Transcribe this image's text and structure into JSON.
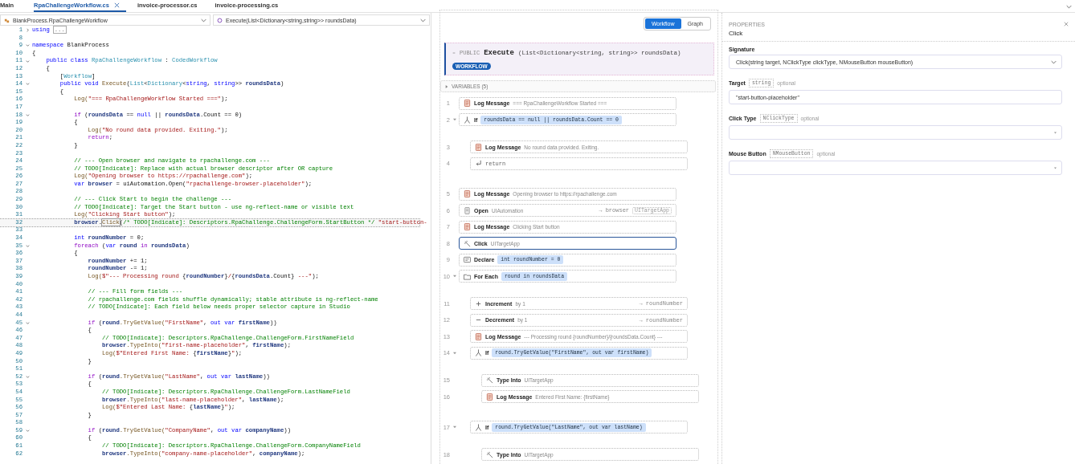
{
  "tabs": [
    {
      "label": "Main",
      "selected": false
    },
    {
      "label": "RpaChallengeWorkflow.cs",
      "selected": true
    },
    {
      "label": "invoice-processor.cs",
      "selected": false
    },
    {
      "label": "invoice-processing.cs",
      "selected": false
    }
  ],
  "navigation": {
    "type_selector": "BlankProcess.RpaChallengeWorkflow",
    "member_selector": "Execute(List<Dictionary<string,string>> roundsData)"
  },
  "editor": {
    "lines": [
      {
        "number": "1",
        "expanded": false,
        "current": false,
        "tokens": [
          {
            "text": "using",
            "kind": "keyword"
          },
          {
            "text": "...",
            "kind": "collapsed"
          }
        ]
      },
      {
        "number": "8",
        "current": false
      },
      {
        "number": "9",
        "expanded": true,
        "current": false,
        "tokens": [
          {
            "text": "namespace",
            "kind": "keyword"
          },
          {
            "text": " BlankProcess",
            "kind": "plain"
          }
        ]
      },
      {
        "number": "10",
        "current": false,
        "tokens": [
          {
            "text": "{",
            "kind": "plain"
          }
        ]
      },
      {
        "number": "11",
        "expanded": true,
        "current": false,
        "tokens": [
          {
            "text": "    public class ",
            "kind": "keyword"
          },
          {
            "text": "RpaChallengeWorkflow",
            "kind": "type"
          },
          {
            "text": " : ",
            "kind": "plain"
          },
          {
            "text": "CodedWorkflow",
            "kind": "type"
          }
        ]
      },
      {
        "number": "12",
        "current": false,
        "tokens": [
          {
            "text": "    {",
            "kind": "plain"
          }
        ]
      },
      {
        "number": "13",
        "current": false,
        "tokens": [
          {
            "text": "        [",
            "kind": "plain"
          },
          {
            "text": "Workflow",
            "kind": "type"
          },
          {
            "text": "]",
            "kind": "plain"
          }
        ]
      },
      {
        "number": "14",
        "expanded": true,
        "current": false,
        "tokens": [
          {
            "text": "        public void ",
            "kind": "keyword"
          },
          {
            "text": "Execute",
            "kind": "method"
          },
          {
            "text": "(",
            "kind": "plain"
          },
          {
            "text": "List",
            "kind": "type"
          },
          {
            "text": "<",
            "kind": "plain"
          },
          {
            "text": "Dictionary",
            "kind": "type"
          },
          {
            "text": "<",
            "kind": "plain"
          },
          {
            "text": "string",
            "kind": "keyword"
          },
          {
            "text": ", ",
            "kind": "plain"
          },
          {
            "text": "string",
            "kind": "keyword"
          },
          {
            "text": ">> ",
            "kind": "plain"
          },
          {
            "text": "roundsData",
            "kind": "ident"
          },
          {
            "text": ")",
            "kind": "plain"
          }
        ]
      },
      {
        "number": "15",
        "current": false,
        "tokens": [
          {
            "text": "        {",
            "kind": "plain"
          }
        ]
      },
      {
        "number": "16",
        "current": false,
        "tokens": [
          {
            "text": "            Log(",
            "kind": "method"
          },
          {
            "text": "\"=== RpaChallengeWorkflow Started ===\"",
            "kind": "string"
          },
          {
            "text": ");",
            "kind": "plain"
          }
        ]
      },
      {
        "number": "17",
        "current": false
      },
      {
        "number": "18",
        "expanded": true,
        "current": false,
        "tokens": [
          {
            "text": "            if",
            "kind": "control"
          },
          {
            "text": " (",
            "kind": "plain"
          },
          {
            "text": "roundsData",
            "kind": "ident"
          },
          {
            "text": " == ",
            "kind": "plain"
          },
          {
            "text": "null",
            "kind": "keyword"
          },
          {
            "text": " || ",
            "kind": "plain"
          },
          {
            "text": "roundsData",
            "kind": "ident"
          },
          {
            "text": ".Count == 0)",
            "kind": "plain"
          }
        ]
      },
      {
        "number": "19",
        "current": false,
        "tokens": [
          {
            "text": "            {",
            "kind": "plain"
          }
        ]
      },
      {
        "number": "20",
        "current": false,
        "tokens": [
          {
            "text": "                Log(",
            "kind": "method"
          },
          {
            "text": "\"No round data provided. Exiting.\"",
            "kind": "string"
          },
          {
            "text": ");",
            "kind": "plain"
          }
        ]
      },
      {
        "number": "21",
        "current": false,
        "tokens": [
          {
            "text": "                return",
            "kind": "control"
          },
          {
            "text": ";",
            "kind": "plain"
          }
        ]
      },
      {
        "number": "22",
        "current": false,
        "tokens": [
          {
            "text": "            }",
            "kind": "plain"
          }
        ]
      },
      {
        "number": "23",
        "current": false
      },
      {
        "number": "24",
        "current": false,
        "tokens": [
          {
            "text": "            // --- Open browser and navigate to rpachallenge.com ---",
            "kind": "comment"
          }
        ]
      },
      {
        "number": "25",
        "current": false,
        "tokens": [
          {
            "text": "            // TODO[Indicate]: Replace with actual browser descriptor after OR capture",
            "kind": "comment"
          }
        ]
      },
      {
        "number": "26",
        "current": false,
        "tokens": [
          {
            "text": "            Log(",
            "kind": "method"
          },
          {
            "text": "\"Opening browser to https://rpachallenge.com\"",
            "kind": "string"
          },
          {
            "text": ");",
            "kind": "plain"
          }
        ]
      },
      {
        "number": "27",
        "current": false,
        "tokens": [
          {
            "text": "            var",
            "kind": "keyword"
          },
          {
            "text": " browser",
            "kind": "ident"
          },
          {
            "text": " = uiAutomation.Open(",
            "kind": "plain"
          },
          {
            "text": "\"rpachallenge-browser-placeholder\"",
            "kind": "string"
          },
          {
            "text": ");",
            "kind": "plain"
          }
        ]
      },
      {
        "number": "28",
        "current": false
      },
      {
        "number": "29",
        "current": false,
        "tokens": [
          {
            "text": "            // --- Click Start to begin the challenge ---",
            "kind": "comment"
          }
        ]
      },
      {
        "number": "30",
        "current": false,
        "tokens": [
          {
            "text": "            // TODO[Indicate]: Target the Start button - use ng-reflect-name or visible text",
            "kind": "comment"
          }
        ]
      },
      {
        "number": "31",
        "current": false,
        "tokens": [
          {
            "text": "            Log(",
            "kind": "method"
          },
          {
            "text": "\"Clicking Start button\"",
            "kind": "string"
          },
          {
            "text": ");",
            "kind": "plain"
          }
        ]
      },
      {
        "number": "32",
        "current": true,
        "tokens": [
          {
            "text": "            browser",
            "kind": "ident"
          },
          {
            "text": ".",
            "kind": "plain"
          },
          {
            "text": "Click",
            "kind": "match"
          },
          {
            "text": "(",
            "kind": "plain"
          },
          {
            "text": "/* TODO[Indicate]: Descriptors.RpaChallenge.ChallengeForm.StartButton */",
            "kind": "comment"
          },
          {
            "text": " \"start-button-",
            "kind": "string"
          }
        ]
      },
      {
        "number": "33",
        "current": false
      },
      {
        "number": "34",
        "current": false,
        "tokens": [
          {
            "text": "            int",
            "kind": "keyword"
          },
          {
            "text": " roundNumber",
            "kind": "ident"
          },
          {
            "text": " = 0;",
            "kind": "plain"
          }
        ]
      },
      {
        "number": "35",
        "expanded": true,
        "current": false,
        "tokens": [
          {
            "text": "            foreach",
            "kind": "control"
          },
          {
            "text": " (",
            "kind": "plain"
          },
          {
            "text": "var",
            "kind": "keyword"
          },
          {
            "text": " round ",
            "kind": "ident"
          },
          {
            "text": "in",
            "kind": "control"
          },
          {
            "text": " roundsData",
            "kind": "ident"
          },
          {
            "text": ")",
            "kind": "plain"
          }
        ]
      },
      {
        "number": "36",
        "current": false,
        "tokens": [
          {
            "text": "            {",
            "kind": "plain"
          }
        ]
      },
      {
        "number": "37",
        "current": false,
        "tokens": [
          {
            "text": "                roundNumber",
            "kind": "ident"
          },
          {
            "text": " += 1;",
            "kind": "plain"
          }
        ]
      },
      {
        "number": "38",
        "current": false,
        "tokens": [
          {
            "text": "                roundNumber",
            "kind": "ident"
          },
          {
            "text": " -= 1;",
            "kind": "plain"
          }
        ]
      },
      {
        "number": "39",
        "current": false,
        "tokens": [
          {
            "text": "                Log(",
            "kind": "method"
          },
          {
            "text": "$\"--- Processing round ",
            "kind": "string"
          },
          {
            "text": "{",
            "kind": "plain"
          },
          {
            "text": "roundNumber",
            "kind": "ident"
          },
          {
            "text": "}",
            "kind": "plain"
          },
          {
            "text": "/",
            "kind": "string"
          },
          {
            "text": "{",
            "kind": "plain"
          },
          {
            "text": "roundsData",
            "kind": "ident"
          },
          {
            "text": ".Count}",
            "kind": "plain"
          },
          {
            "text": " ---\"",
            "kind": "string"
          },
          {
            "text": ");",
            "kind": "plain"
          }
        ]
      },
      {
        "number": "40",
        "current": false
      },
      {
        "number": "41",
        "current": false,
        "tokens": [
          {
            "text": "                // --- Fill form fields ---",
            "kind": "comment"
          }
        ]
      },
      {
        "number": "42",
        "current": false,
        "tokens": [
          {
            "text": "                // rpachallenge.com fields shuffle dynamically; stable attribute is ng-reflect-name",
            "kind": "comment"
          }
        ]
      },
      {
        "number": "43",
        "current": false,
        "tokens": [
          {
            "text": "                // TODO[Indicate]: Each field below needs proper selector capture in Studio",
            "kind": "comment"
          }
        ]
      },
      {
        "number": "44",
        "current": false
      },
      {
        "number": "45",
        "expanded": true,
        "current": false,
        "tokens": [
          {
            "text": "                if",
            "kind": "control"
          },
          {
            "text": " (",
            "kind": "plain"
          },
          {
            "text": "round",
            "kind": "ident"
          },
          {
            "text": ".TryGetValue(",
            "kind": "method"
          },
          {
            "text": "\"FirstName\"",
            "kind": "string"
          },
          {
            "text": ", ",
            "kind": "plain"
          },
          {
            "text": "out var",
            "kind": "keyword"
          },
          {
            "text": " firstName",
            "kind": "ident"
          },
          {
            "text": "))",
            "kind": "plain"
          }
        ]
      },
      {
        "number": "46",
        "current": false,
        "tokens": [
          {
            "text": "                {",
            "kind": "plain"
          }
        ]
      },
      {
        "number": "47",
        "current": false,
        "tokens": [
          {
            "text": "                    // TODO[Indicate]: Descriptors.RpaChallenge.ChallengeForm.FirstNameField",
            "kind": "comment"
          }
        ]
      },
      {
        "number": "48",
        "current": false,
        "tokens": [
          {
            "text": "                    browser",
            "kind": "ident"
          },
          {
            "text": ".TypeInto(",
            "kind": "method"
          },
          {
            "text": "\"first-name-placeholder\"",
            "kind": "string"
          },
          {
            "text": ", ",
            "kind": "plain"
          },
          {
            "text": "firstName",
            "kind": "ident"
          },
          {
            "text": ");",
            "kind": "plain"
          }
        ]
      },
      {
        "number": "49",
        "current": false,
        "tokens": [
          {
            "text": "                    Log(",
            "kind": "method"
          },
          {
            "text": "$\"Entered First Name: ",
            "kind": "string"
          },
          {
            "text": "{",
            "kind": "plain"
          },
          {
            "text": "firstName",
            "kind": "ident"
          },
          {
            "text": "}",
            "kind": "plain"
          },
          {
            "text": "\"",
            "kind": "string"
          },
          {
            "text": ");",
            "kind": "plain"
          }
        ]
      },
      {
        "number": "50",
        "current": false,
        "tokens": [
          {
            "text": "                }",
            "kind": "plain"
          }
        ]
      },
      {
        "number": "51",
        "current": false
      },
      {
        "number": "52",
        "expanded": true,
        "current": false,
        "tokens": [
          {
            "text": "                if",
            "kind": "control"
          },
          {
            "text": " (",
            "kind": "plain"
          },
          {
            "text": "round",
            "kind": "ident"
          },
          {
            "text": ".TryGetValue(",
            "kind": "method"
          },
          {
            "text": "\"LastName\"",
            "kind": "string"
          },
          {
            "text": ", ",
            "kind": "plain"
          },
          {
            "text": "out var",
            "kind": "keyword"
          },
          {
            "text": " lastName",
            "kind": "ident"
          },
          {
            "text": "))",
            "kind": "plain"
          }
        ]
      },
      {
        "number": "53",
        "current": false,
        "tokens": [
          {
            "text": "                {",
            "kind": "plain"
          }
        ]
      },
      {
        "number": "54",
        "current": false,
        "tokens": [
          {
            "text": "                    // TODO[Indicate]: Descriptors.RpaChallenge.ChallengeForm.LastNameField",
            "kind": "comment"
          }
        ]
      },
      {
        "number": "55",
        "current": false,
        "tokens": [
          {
            "text": "                    browser",
            "kind": "ident"
          },
          {
            "text": ".TypeInto(",
            "kind": "method"
          },
          {
            "text": "\"last-name-placeholder\"",
            "kind": "string"
          },
          {
            "text": ", ",
            "kind": "plain"
          },
          {
            "text": "lastName",
            "kind": "ident"
          },
          {
            "text": ");",
            "kind": "plain"
          }
        ]
      },
      {
        "number": "56",
        "current": false,
        "tokens": [
          {
            "text": "                    Log(",
            "kind": "method"
          },
          {
            "text": "$\"Entered Last Name: ",
            "kind": "string"
          },
          {
            "text": "{",
            "kind": "plain"
          },
          {
            "text": "lastName",
            "kind": "ident"
          },
          {
            "text": "}",
            "kind": "plain"
          },
          {
            "text": "\"",
            "kind": "string"
          },
          {
            "text": ");",
            "kind": "plain"
          }
        ]
      },
      {
        "number": "57",
        "current": false,
        "tokens": [
          {
            "text": "                }",
            "kind": "plain"
          }
        ]
      },
      {
        "number": "58",
        "current": false
      },
      {
        "number": "59",
        "expanded": true,
        "current": false,
        "tokens": [
          {
            "text": "                if",
            "kind": "control"
          },
          {
            "text": " (",
            "kind": "plain"
          },
          {
            "text": "round",
            "kind": "ident"
          },
          {
            "text": ".TryGetValue(",
            "kind": "method"
          },
          {
            "text": "\"CompanyName\"",
            "kind": "string"
          },
          {
            "text": ", ",
            "kind": "plain"
          },
          {
            "text": "out var",
            "kind": "keyword"
          },
          {
            "text": " companyName",
            "kind": "ident"
          },
          {
            "text": "))",
            "kind": "plain"
          }
        ]
      },
      {
        "number": "60",
        "current": false,
        "tokens": [
          {
            "text": "                {",
            "kind": "plain"
          }
        ]
      },
      {
        "number": "61",
        "current": false,
        "tokens": [
          {
            "text": "                    // TODO[Indicate]: Descriptors.RpaChallenge.ChallengeForm.CompanyNameField",
            "kind": "comment"
          }
        ]
      },
      {
        "number": "62",
        "current": false,
        "tokens": [
          {
            "text": "                    browser",
            "kind": "ident"
          },
          {
            "text": ".TypeInto(",
            "kind": "method"
          },
          {
            "text": "\"company-name-placeholder\"",
            "kind": "string"
          },
          {
            "text": ", ",
            "kind": "plain"
          },
          {
            "text": "companyName",
            "kind": "ident"
          },
          {
            "text": ");",
            "kind": "plain"
          }
        ]
      }
    ]
  },
  "workflow": {
    "view_toggle": [
      {
        "label": "Workflow",
        "selected": true
      },
      {
        "label": "Graph",
        "selected": false
      }
    ],
    "method": {
      "modifier": "PUBLIC",
      "name": "Execute",
      "signature": "(List<Dictionary<string, string>> roundsData)",
      "badge": "WORKFLOW"
    },
    "variables": {
      "label": "VARIABLES (5)",
      "expanded": false
    },
    "steps": [
      {
        "number": "1",
        "kind": "log",
        "title": "Log Message",
        "detail": "=== RpaChallengeWorkflow Started ===",
        "selected": false
      },
      {
        "number": "2",
        "kind": "if",
        "title": "If",
        "expression": "roundsData == null || roundsData.Count == 0",
        "expanded": true,
        "selected": false,
        "children": [
          {
            "number": "3",
            "kind": "log",
            "title": "Log Message",
            "detail": "No round data provided. Exiting.",
            "selected": false
          },
          {
            "number": "4",
            "kind": "return",
            "title": "return",
            "selected": false
          }
        ]
      },
      {
        "number": "5",
        "kind": "log",
        "title": "Log Message",
        "detail": "Opening browser to https://rpachallenge.com",
        "selected": false
      },
      {
        "number": "6",
        "kind": "open",
        "title": "Open",
        "detail": "UIAutomation",
        "output": "→ browser",
        "tag": "UITargetApp",
        "selected": false
      },
      {
        "number": "7",
        "kind": "log",
        "title": "Log Message",
        "detail": "Clicking Start button",
        "selected": false
      },
      {
        "number": "8",
        "kind": "click",
        "title": "Click",
        "detail": "UITargetApp",
        "selected": true
      },
      {
        "number": "9",
        "kind": "declare",
        "title": "Declare",
        "expression": "int roundNumber = 0",
        "selected": false
      },
      {
        "number": "10",
        "kind": "foreach",
        "title": "For Each",
        "expression": "round in roundsData",
        "expanded": true,
        "selected": false,
        "children": [
          {
            "number": "11",
            "kind": "increment",
            "title": "Increment",
            "detail": "by 1",
            "output": "→ roundNumber",
            "selected": false
          },
          {
            "number": "12",
            "kind": "decrement",
            "title": "Decrement",
            "detail": "by 1",
            "output": "→ roundNumber",
            "selected": false
          },
          {
            "number": "13",
            "kind": "log",
            "title": "Log Message",
            "detail": "--- Processing round {roundNumber}/{roundsData.Count} ---",
            "selected": false
          },
          {
            "number": "14",
            "kind": "if",
            "title": "If",
            "expression": "round.TryGetValue(\"FirstName\", out var firstName)",
            "expanded": true,
            "selected": false,
            "children": [
              {
                "number": "15",
                "kind": "typeinto",
                "title": "Type Into",
                "detail": "UITargetApp",
                "selected": false
              },
              {
                "number": "16",
                "kind": "log",
                "title": "Log Message",
                "detail": "Entered First Name: {firstName}",
                "selected": false
              }
            ]
          },
          {
            "number": "17",
            "kind": "if",
            "title": "If",
            "expression": "round.TryGetValue(\"LastName\", out var lastName)",
            "expanded": true,
            "selected": false,
            "children": [
              {
                "number": "18",
                "kind": "typeinto",
                "title": "Type Into",
                "detail": "UITargetApp",
                "selected": false
              }
            ]
          }
        ]
      }
    ]
  },
  "properties": {
    "header": "PROPERTIES",
    "title": "Click",
    "fields": [
      {
        "kind": "select",
        "label": "Signature",
        "value": "Click(string target, NClickType clickType, NMouseButton mouseButton)"
      },
      {
        "kind": "input",
        "label": "Target",
        "type": "string",
        "note": "optional",
        "value": "\"start-button-placeholder\""
      },
      {
        "kind": "select",
        "label": "Click Type",
        "type": "NClickType",
        "note": "optional"
      },
      {
        "kind": "select",
        "label": "Mouse Button",
        "type": "NMouseButton",
        "note": "optional"
      }
    ]
  }
}
